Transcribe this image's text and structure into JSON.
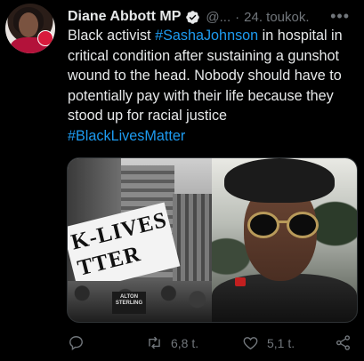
{
  "tweet": {
    "author_name": "Diane Abbott MP",
    "handle": "@...",
    "separator": "·",
    "date": "24. toukok.",
    "more": "•••",
    "text_parts": [
      "Black activist ",
      "#SashaJohnson",
      " in hospital in critical condition after sustaining a gunshot wound to the head. Nobody should have to potentially pay with their life because they stood up for racial justice",
      "#BlackLivesMatter"
    ],
    "media": {
      "left_banner_line1": "K-LIVES",
      "left_banner_line2": "TTER",
      "left_sign": "ALTON STERLING"
    },
    "actions": {
      "reply_count": "",
      "retweet_count": "6,8 t.",
      "like_count": "5,1 t."
    }
  },
  "colors": {
    "background": "#000000",
    "text": "#e7e9ea",
    "muted": "#71767b",
    "link": "#1d9bf0"
  },
  "icons": [
    "verified-badge-icon",
    "more-icon",
    "reply-icon",
    "retweet-icon",
    "like-icon",
    "share-icon"
  ]
}
